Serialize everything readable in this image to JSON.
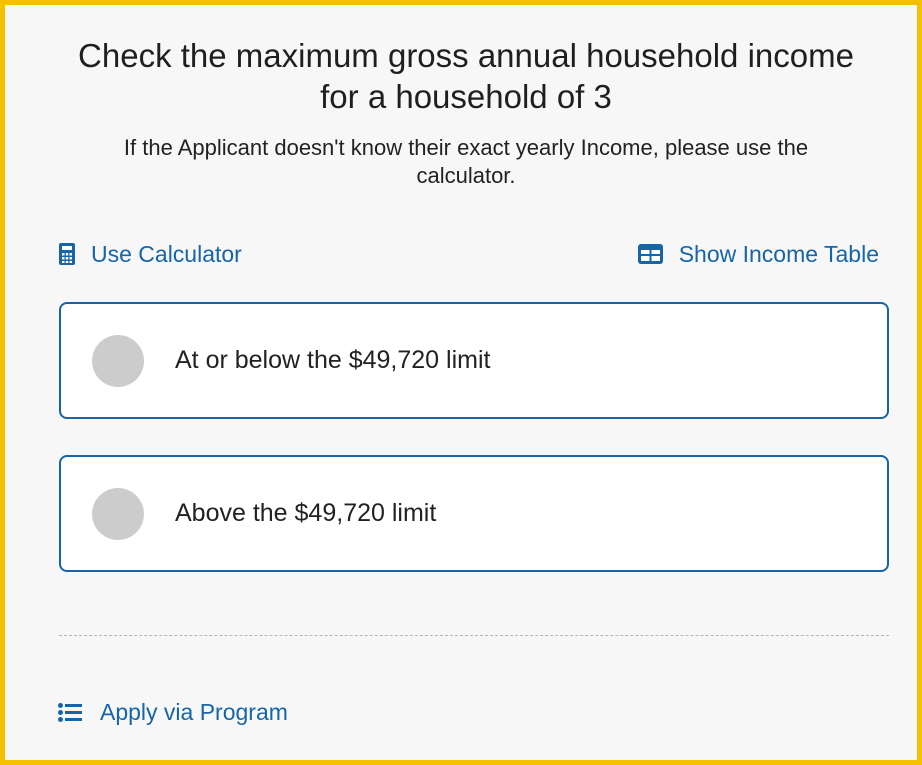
{
  "header": {
    "title_line1": "Check the maximum gross annual household income",
    "title_line2": "for a household of 3",
    "subtitle_line1": "If the Applicant doesn't know their exact yearly Income, please use the",
    "subtitle_line2": "calculator."
  },
  "links": {
    "calculator_label": "Use Calculator",
    "calculator_icon": "calculator-icon",
    "income_table_label": "Show Income Table",
    "income_table_icon": "table-icon",
    "program_label": "Apply via Program",
    "program_icon": "list-icon"
  },
  "options": [
    {
      "label": "At or below the $49,720 limit",
      "selected": false
    },
    {
      "label": "Above the $49,720 limit",
      "selected": false
    }
  ],
  "colors": {
    "border_highlight": "#f5c000",
    "accent": "#1565a8",
    "radio_unselected": "#cccccc",
    "background": "#f7f7f7"
  }
}
